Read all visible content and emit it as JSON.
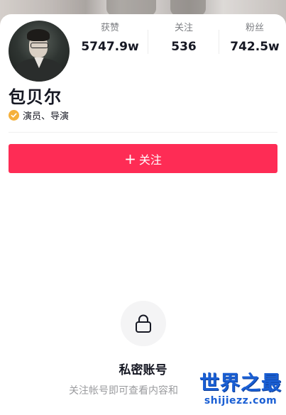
{
  "profile": {
    "name": "包贝尔",
    "verification": "演员、导演",
    "stats": [
      {
        "label": "获赞",
        "value": "5747.9w"
      },
      {
        "label": "关注",
        "value": "536"
      },
      {
        "label": "粉丝",
        "value": "742.5w"
      }
    ]
  },
  "actions": {
    "follow_plus": "+",
    "follow_label": "关注"
  },
  "private": {
    "title": "私密账号",
    "description": "关注帐号即可查看内容和"
  },
  "watermark": {
    "cn": "世界之最",
    "en": "shijiezz.com"
  },
  "icons": {
    "verify": "verified-check-icon",
    "lock": "lock-icon"
  },
  "colors": {
    "accent": "#fe2c55",
    "verify_badge": "#f5b03b",
    "watermark": "#1a5fd4"
  }
}
